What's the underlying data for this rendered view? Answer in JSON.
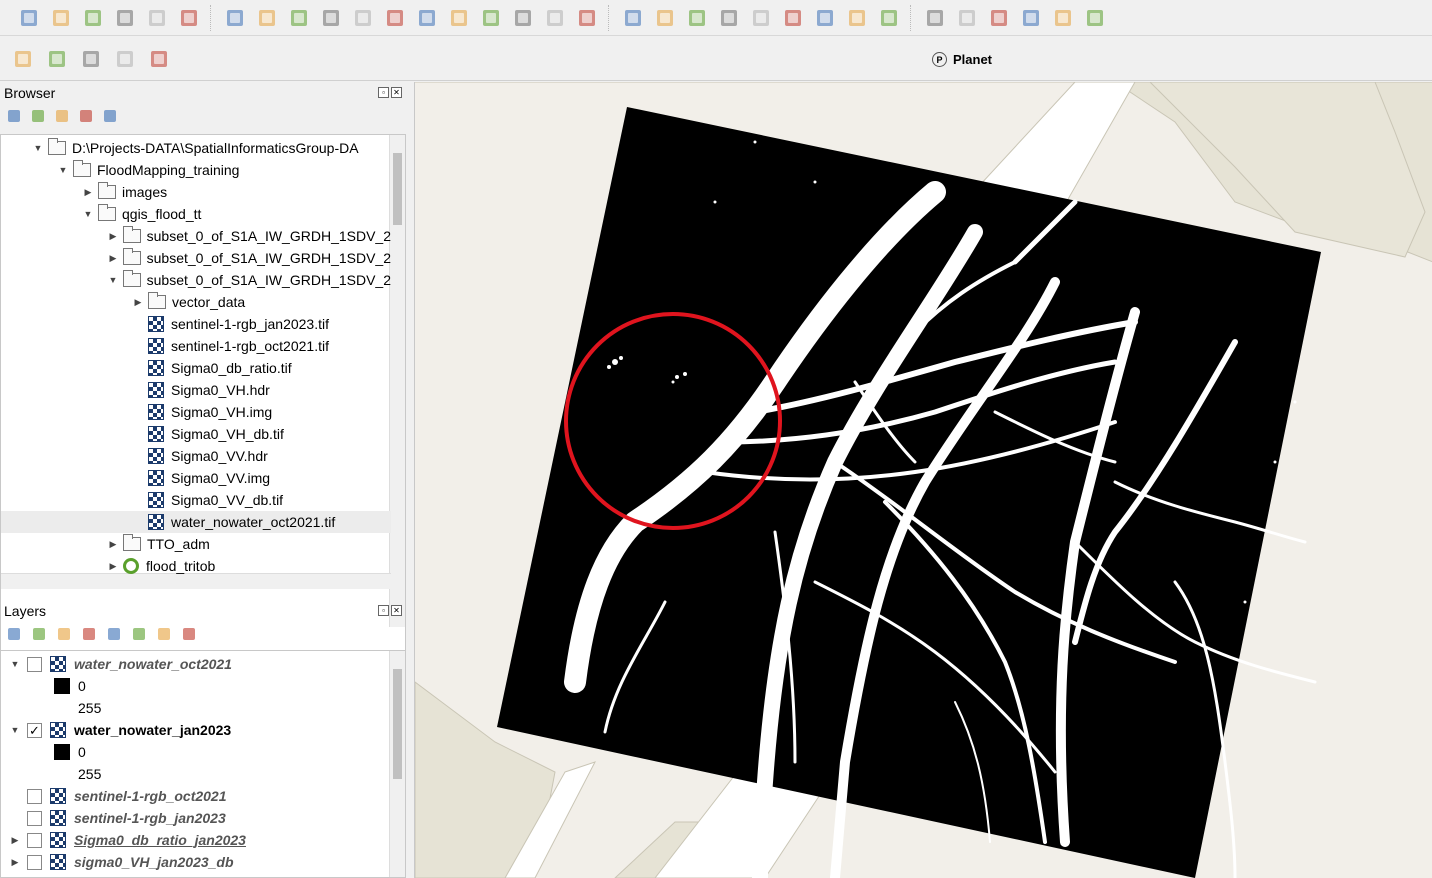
{
  "toolbar": {
    "row1_icons": [
      "open-project-icon",
      "new-geopackage-icon",
      "digitize-icon",
      "pen-icon",
      "save-icon",
      "vertex-icon",
      "edit-pencil-icon",
      "pencil-icon",
      "save-edits-icon",
      "add-feature-icon",
      "node-tool-icon",
      "attribute-table-icon",
      "delete-icon",
      "cut-icon",
      "copy-icon",
      "paste-icon",
      "undo-icon",
      "redo-icon",
      "label-abc-icon",
      "label-pin-icon",
      "label-toggle-icon",
      "label-red-icon",
      "label-tool-1-icon",
      "label-tool-2-icon",
      "label-tool-3-icon",
      "label-tool-4-icon",
      "label-tool-5-icon",
      "osm-icon",
      "python-icon",
      "plugin-gear-icon",
      "cloud-icon",
      "globe-icon",
      "help-icon"
    ],
    "row2_icons": [
      "gpx-icon",
      "zoom-icon",
      "map-icon",
      "geo-pin-icon",
      "satellite-icon"
    ],
    "planet_logo": "P",
    "planet_label": "Planet"
  },
  "browser": {
    "title": "Browser",
    "toolbar_icons": [
      "add-selected-icon",
      "refresh-icon",
      "filter-icon",
      "collapse-icon",
      "info-icon"
    ],
    "items": [
      {
        "label": "D:\\Projects-DATA\\SpatialInformaticsGroup-DA",
        "type": "folder",
        "depth": 0,
        "expanded": true
      },
      {
        "label": "FloodMapping_training",
        "type": "folder",
        "depth": 1,
        "expanded": true
      },
      {
        "label": "images",
        "type": "folder",
        "depth": 2,
        "expanded": false
      },
      {
        "label": "qgis_flood_tt",
        "type": "folder",
        "depth": 2,
        "expanded": true
      },
      {
        "label": "subset_0_of_S1A_IW_GRDH_1SDV_2",
        "type": "folder",
        "depth": 3,
        "expanded": false
      },
      {
        "label": "subset_0_of_S1A_IW_GRDH_1SDV_2",
        "type": "folder",
        "depth": 3,
        "expanded": false
      },
      {
        "label": "subset_0_of_S1A_IW_GRDH_1SDV_2",
        "type": "folder",
        "depth": 3,
        "expanded": true
      },
      {
        "label": "vector_data",
        "type": "folder",
        "depth": 4,
        "expanded": false
      },
      {
        "label": "sentinel-1-rgb_jan2023.tif",
        "type": "raster",
        "depth": 4
      },
      {
        "label": "sentinel-1-rgb_oct2021.tif",
        "type": "raster",
        "depth": 4
      },
      {
        "label": "Sigma0_db_ratio.tif",
        "type": "raster",
        "depth": 4
      },
      {
        "label": "Sigma0_VH.hdr",
        "type": "raster",
        "depth": 4
      },
      {
        "label": "Sigma0_VH.img",
        "type": "raster",
        "depth": 4
      },
      {
        "label": "Sigma0_VH_db.tif",
        "type": "raster",
        "depth": 4
      },
      {
        "label": "Sigma0_VV.hdr",
        "type": "raster",
        "depth": 4
      },
      {
        "label": "Sigma0_VV.img",
        "type": "raster",
        "depth": 4
      },
      {
        "label": "Sigma0_VV_db.tif",
        "type": "raster",
        "depth": 4
      },
      {
        "label": "water_nowater_oct2021.tif",
        "type": "raster",
        "depth": 4,
        "selected": true
      },
      {
        "label": "TTO_adm",
        "type": "folder",
        "depth": 3,
        "expanded": false
      },
      {
        "label": "flood_tritob",
        "type": "qgs",
        "depth": 3,
        "expanded": false
      }
    ]
  },
  "layers": {
    "title": "Layers",
    "toolbar_icons": [
      "style-icon",
      "add-group-icon",
      "visibility-icon",
      "filter-icon",
      "filter-expression-icon",
      "expand-icon",
      "collapse-icon",
      "remove-layer-icon"
    ],
    "items": [
      {
        "label": "water_nowater_oct2021",
        "kind": "layer",
        "checked": false,
        "expanded": true,
        "style": "italic"
      },
      {
        "label": "0",
        "kind": "legend",
        "swatch": "#000000"
      },
      {
        "label": "255",
        "kind": "legend",
        "swatch": null
      },
      {
        "label": "water_nowater_jan2023",
        "kind": "layer",
        "checked": true,
        "expanded": true,
        "style": "bold"
      },
      {
        "label": "0",
        "kind": "legend",
        "swatch": "#000000"
      },
      {
        "label": "255",
        "kind": "legend",
        "swatch": null
      },
      {
        "label": "sentinel-1-rgb_oct2021",
        "kind": "layer",
        "checked": false,
        "expanded": false,
        "style": "italic"
      },
      {
        "label": "sentinel-1-rgb_jan2023",
        "kind": "layer",
        "checked": false,
        "expanded": false,
        "style": "italic"
      },
      {
        "label": "Sigma0_db_ratio_jan2023",
        "kind": "layer",
        "checked": false,
        "expanded": false,
        "collapsible": true,
        "style": "italic-underline"
      },
      {
        "label": "sigma0_VH_jan2023_db",
        "kind": "layer",
        "checked": false,
        "expanded": false,
        "collapsible": true,
        "style": "italic"
      }
    ]
  },
  "map": {
    "background": "#f2efe9",
    "land_color": "#e6e3d5",
    "raster_color": "#000000",
    "water_color": "#ffffff",
    "highlight_circle_color": "#e0141e"
  }
}
